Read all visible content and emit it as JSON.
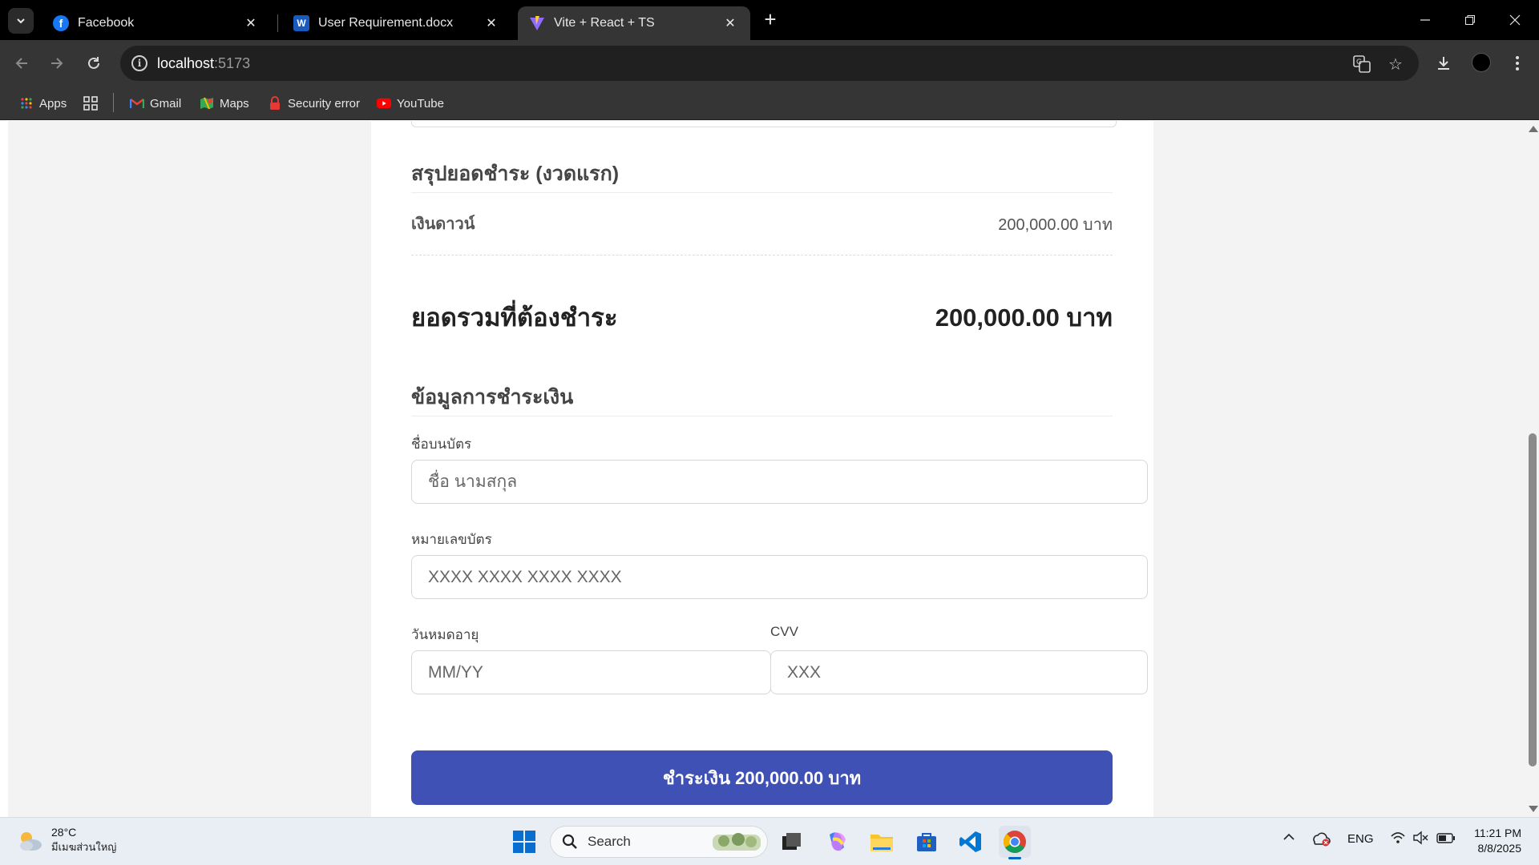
{
  "browser": {
    "tabs": [
      {
        "title": "Facebook",
        "icon": "facebook-icon",
        "active": false
      },
      {
        "title": "User Requirement.docx",
        "icon": "word-icon",
        "active": false
      },
      {
        "title": "Vite + React + TS",
        "icon": "vite-icon",
        "active": true
      }
    ],
    "url_host": "localhost",
    "url_port": ":5173",
    "bookmarks": [
      {
        "label": "Apps",
        "icon": "apps-grid-icon"
      },
      {
        "label": "Gmail",
        "icon": "gmail-icon"
      },
      {
        "label": "Maps",
        "icon": "maps-icon"
      },
      {
        "label": "Security error",
        "icon": "security-error-icon"
      },
      {
        "label": "YouTube",
        "icon": "youtube-icon"
      }
    ]
  },
  "summary": {
    "title": "สรุปยอดชำระ (งวดแรก)",
    "down_payment_label": "เงินดาวน์",
    "down_payment_value": "200,000.00 บาท",
    "total_label": "ยอดรวมที่ต้องชำระ",
    "total_value": "200,000.00 บาท"
  },
  "payment": {
    "title": "ข้อมูลการชำระเงิน",
    "card_name_label": "ชื่อบนบัตร",
    "card_name_placeholder": "ชื่อ นามสกุล",
    "card_number_label": "หมายเลขบัตร",
    "card_number_placeholder": "XXXX XXXX XXXX XXXX",
    "expiry_label": "วันหมดอายุ",
    "expiry_placeholder": "MM/YY",
    "cvv_label": "CVV",
    "cvv_placeholder": "XXX",
    "pay_button": "ชำระเงิน 200,000.00 บาท",
    "accent_color": "#3f51b5"
  },
  "taskbar": {
    "weather_temp": "28°C",
    "weather_desc": "มีเมฆส่วนใหญ่",
    "search_placeholder": "Search",
    "language": "ENG",
    "time": "11:21 PM",
    "date": "8/8/2025"
  }
}
